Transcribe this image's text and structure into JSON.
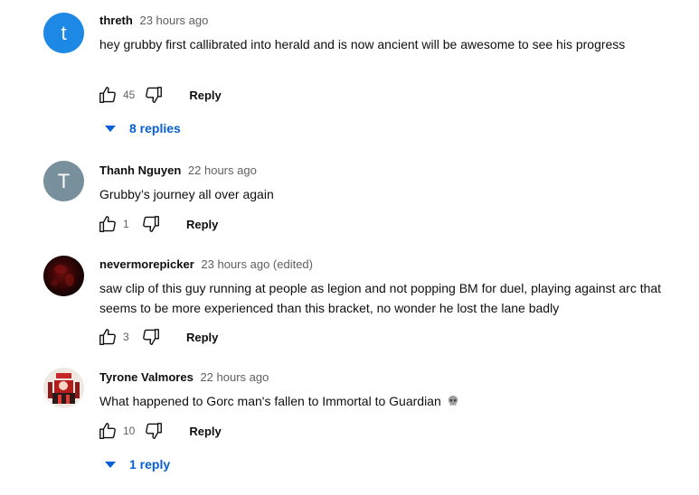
{
  "comments": [
    {
      "avatar_letter": "t",
      "author": "threth",
      "time": "23 hours ago",
      "text": "hey grubby first callibrated into herald and is now ancient will be awesome to see his progress",
      "likes": "45",
      "reply_label": "Reply",
      "replies_label": "8 replies"
    },
    {
      "avatar_letter": "T",
      "author": "Thanh Nguyen",
      "time": "22 hours ago",
      "text": "Grubby’s journey all over again",
      "likes": "1",
      "reply_label": "Reply"
    },
    {
      "author": "nevermorepicker",
      "time": "23 hours ago (edited)",
      "text": "saw clip of this guy running at people as legion and not popping BM for duel, playing against arc that seems to be more experienced than this bracket, no wonder he lost the lane badly",
      "likes": "3",
      "reply_label": "Reply"
    },
    {
      "author": "Tyrone Valmores",
      "time": "22 hours ago",
      "text": "What happened to Gorc man's fallen to Immortal to Guardian",
      "emoji_icon": "skull-emoji",
      "likes": "10",
      "reply_label": "Reply",
      "replies_label": "1 reply"
    }
  ],
  "colors": {
    "link_blue": "#065fd4",
    "secondary_text": "#606060",
    "avatar_blue": "#1e88e5",
    "avatar_gray": "#78909c"
  },
  "icons": {
    "like": "thumbs-up-icon",
    "dislike": "thumbs-down-icon",
    "expand": "chevron-down-icon"
  }
}
